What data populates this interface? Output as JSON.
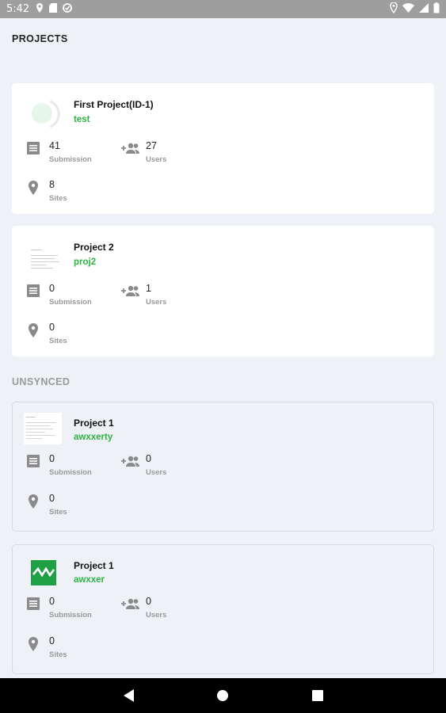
{
  "status_bar": {
    "time": "5:42"
  },
  "sections": {
    "projects": "PROJECTS",
    "unsynced": "UNSYNCED"
  },
  "cards": [
    {
      "name": "First Project(ID-1)",
      "desc": "test",
      "submission": "41",
      "submission_label": "Submission",
      "users": "27",
      "users_label": "Users",
      "sites": "8",
      "sites_label": "Sites"
    },
    {
      "name": "Project 2",
      "desc": "proj2",
      "submission": "0",
      "submission_label": "Submission",
      "users": "1",
      "users_label": "Users",
      "sites": "0",
      "sites_label": "Sites"
    },
    {
      "name": "Project 1",
      "desc": "awxxerty",
      "submission": "0",
      "submission_label": "Submission",
      "users": "0",
      "users_label": "Users",
      "sites": "0",
      "sites_label": "Sites"
    },
    {
      "name": "Project 1",
      "desc": "awxxer",
      "submission": "0",
      "submission_label": "Submission",
      "users": "0",
      "users_label": "Users",
      "sites": "0",
      "sites_label": "Sites"
    }
  ],
  "colors": {
    "accent_green": "#2fb344",
    "status_bar": "#9e9e9e",
    "background": "#eef1f5"
  },
  "icons": {
    "submission": "list-doc-icon",
    "users": "add-users-icon",
    "sites": "location-pin-icon"
  }
}
